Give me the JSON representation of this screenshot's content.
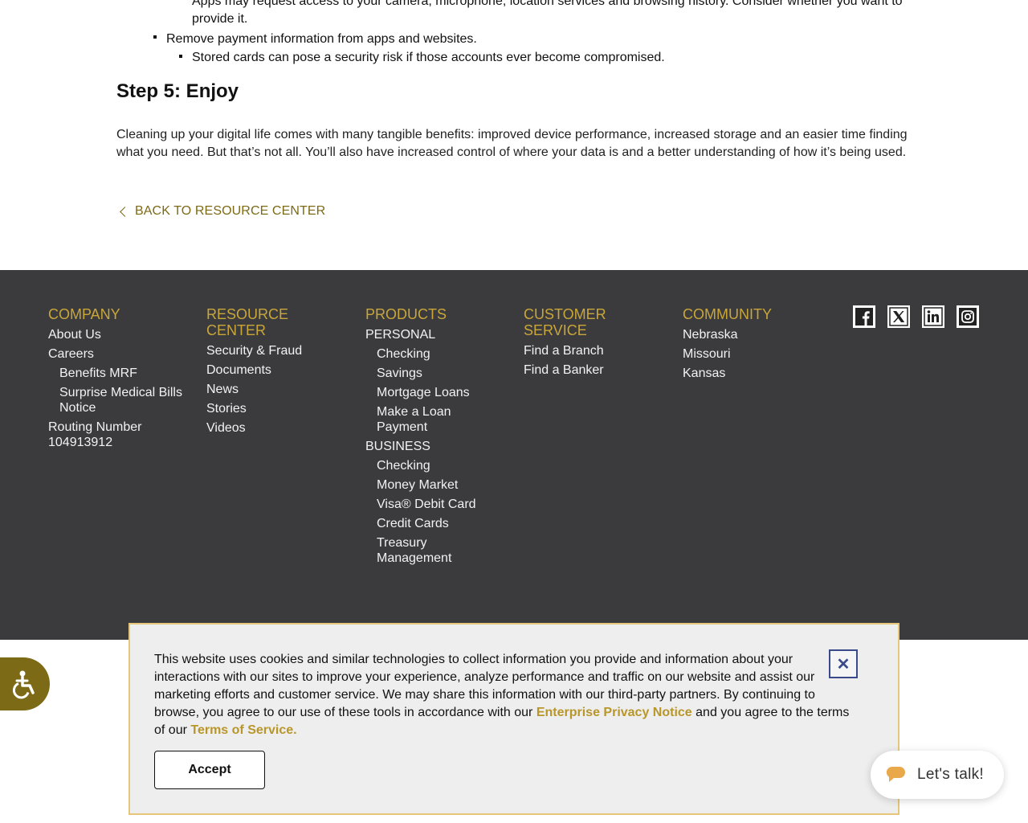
{
  "article": {
    "bullet_partial": "Apps may request access to your camera, microphone, location services and browsing history. Consider whether you want to",
    "bullet_partial_2": "provide it.",
    "bullet_main": "Remove payment information from apps and websites.",
    "bullet_sub": "Stored cards can pose a security risk if those accounts ever become compromised.",
    "step_title": "Step 5: Enjoy",
    "paragraph": "Cleaning up your digital life comes with many tangible benefits: improved device performance, increased storage and an easier time finding what you need. But that’s not all. You’ll also have increased control of where your data is and a better understanding of how it’s being used.",
    "back_link": "BACK TO RESOURCE CENTER"
  },
  "footer": {
    "company": {
      "heading": "COMPANY",
      "about": "About Us",
      "careers": "Careers",
      "benefits": "Benefits MRF",
      "surprise": "Surprise Medical Bills Notice",
      "routing": "Routing Number 104913912"
    },
    "resource": {
      "heading": "RESOURCE CENTER",
      "security": "Security & Fraud",
      "documents": "Documents",
      "news": "News",
      "stories": "Stories",
      "videos": "Videos"
    },
    "products": {
      "heading": "PRODUCTS",
      "personal": "PERSONAL",
      "p_checking": "Checking",
      "p_savings": "Savings",
      "p_mortgage": "Mortgage Loans",
      "p_loan_payment": "Make a Loan Payment",
      "business": "BUSINESS",
      "b_checking": "Checking",
      "b_money_market": "Money Market",
      "b_visa": "Visa® Debit Card",
      "b_credit": "Credit Cards",
      "b_treasury": "Treasury Management"
    },
    "customer": {
      "heading": "CUSTOMER SERVICE",
      "branch": "Find a Branch",
      "banker": "Find a Banker"
    },
    "community": {
      "heading": "COMMUNITY",
      "nebraska": "Nebraska",
      "missouri": "Missouri",
      "kansas": "Kansas"
    },
    "social_icons": [
      "facebook-icon",
      "x-icon",
      "linkedin-icon",
      "instagram-icon"
    ]
  },
  "cookie": {
    "text_before": "This website uses cookies and similar technologies to collect information you provide and information about your interactions with our sites to improve your experience, analyze performance and traffic on our website and assist our marketing efforts and customer service. We may share this information with our third-party partners. By continuing to browse, you agree to our use of these tools in accordance with our ",
    "privacy_link": "Enterprise Privacy Notice",
    "text_middle": " and you agree to the terms of our ",
    "terms_link": "Terms of Service.",
    "close_symbol": "✕",
    "accept_label": "Accept"
  },
  "chat": {
    "label": "Let's talk!"
  },
  "colors": {
    "gold_accent": "#c9a63a",
    "link_olive": "#7d6a16",
    "footer_bg": "#3b3b3d",
    "cookie_bg": "#eeeeee"
  }
}
